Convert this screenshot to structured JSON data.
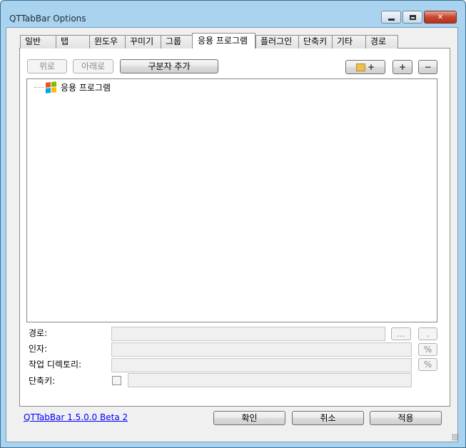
{
  "window": {
    "title": "QTTabBar Options"
  },
  "tabs": [
    {
      "label": "일반"
    },
    {
      "label": "탭"
    },
    {
      "label": "윈도우"
    },
    {
      "label": "꾸미기"
    },
    {
      "label": "그룹"
    },
    {
      "label": "응용 프로그램",
      "active": true
    },
    {
      "label": "플러그인"
    },
    {
      "label": "단축키"
    },
    {
      "label": "기타"
    },
    {
      "label": "경로"
    }
  ],
  "toolbar": {
    "up_label": "위로",
    "down_label": "아래로",
    "add_separator_label": "구분자 추가",
    "add_folder_label": "+",
    "add_label": "+",
    "remove_label": "−"
  },
  "tree": {
    "root_label": "응용 프로그램",
    "root_icon": "windows-flag-icon"
  },
  "form": {
    "path_label": "경로:",
    "path_value": "",
    "browse_label": "...",
    "dot_label": ".",
    "args_label": "인자:",
    "args_value": "",
    "args_var_label": "%",
    "workdir_label": "작업 디렉토리:",
    "workdir_value": "",
    "workdir_var_label": "%",
    "shortcut_label": "단축키:",
    "shortcut_value": ""
  },
  "footer": {
    "version_link": "QTTabBar 1.5.0.0 Beta 2",
    "ok_label": "확인",
    "cancel_label": "취소",
    "apply_label": "적용"
  },
  "colors": {
    "frame": "#a9d3ef",
    "close": "#c7452f",
    "link": "#0000ff"
  }
}
